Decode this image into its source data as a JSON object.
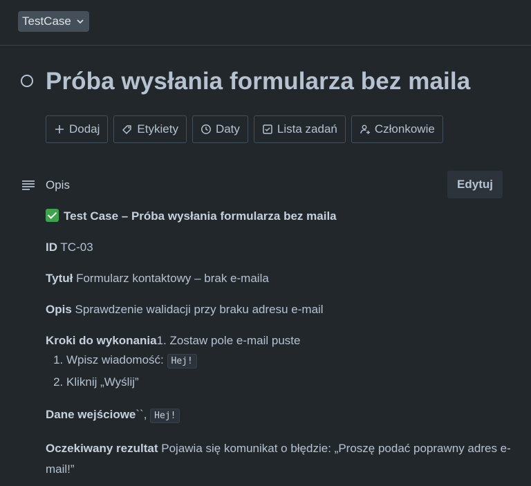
{
  "header": {
    "type_label": "TestCase"
  },
  "card": {
    "title": "Próba wysłania formularza bez maila"
  },
  "actions": [
    {
      "label": "Dodaj",
      "icon": "plus-icon"
    },
    {
      "label": "Etykiety",
      "icon": "tag-icon"
    },
    {
      "label": "Daty",
      "icon": "clock-icon"
    },
    {
      "label": "Lista zadań",
      "icon": "checkbox-icon"
    },
    {
      "label": "Członkowie",
      "icon": "add-member-icon"
    }
  ],
  "description": {
    "label": "Opis",
    "edit_label": "Edytuj",
    "heading": "Test Case  – Próba wysłania formularza bez maila",
    "id_label": "ID",
    "id_value": "TC-03",
    "title_label": "Tytuł",
    "title_value": "Formularz kontaktowy – brak e-maila",
    "desc_label": "Opis",
    "desc_value": "Sprawdzenie walidacji przy braku adresu e-mail",
    "steps_label": "Kroki do wykonania",
    "steps_inline": "1. Zostaw pole e-mail puste",
    "steps": [
      {
        "text": "Wpisz wiadomość:",
        "code": "Hej!"
      },
      {
        "text": "Kliknij „Wyślij”"
      }
    ],
    "input_label": "Dane wejściowe",
    "input_sep": "``,",
    "input_code": "Hej!",
    "expected_label": "Oczekiwany rezultat",
    "expected_value": "Pojawia się komunikat o błędzie: „Proszę podać poprawny adres e-mail!”"
  }
}
